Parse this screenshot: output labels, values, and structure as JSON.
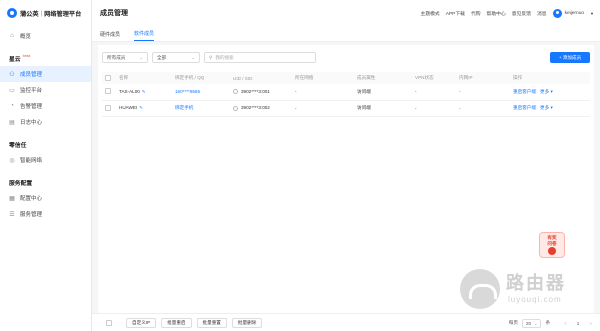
{
  "brand": {
    "name": "蒲公英",
    "subtitle": "网络管理平台"
  },
  "sidebar": {
    "top_items": [
      {
        "label": "概览",
        "icon": "home-icon"
      }
    ],
    "groups": [
      {
        "title": "星云",
        "tag": "beta",
        "items": [
          {
            "label": "成员管理",
            "icon": "users-icon",
            "active": true
          },
          {
            "label": "监控平台",
            "icon": "monitor-icon"
          },
          {
            "label": "告警管理",
            "icon": "bell-icon"
          },
          {
            "label": "日志中心",
            "icon": "log-icon"
          }
        ]
      },
      {
        "title": "零信任",
        "items": [
          {
            "label": "智能网络",
            "icon": "network-icon"
          }
        ]
      },
      {
        "title": "服务配置",
        "items": [
          {
            "label": "配置中心",
            "icon": "grid-icon"
          },
          {
            "label": "服务管理",
            "icon": "list-icon"
          }
        ]
      }
    ]
  },
  "header": {
    "title": "成员管理",
    "links": [
      "主题模式",
      "APP下载",
      "代购",
      "帮助中心",
      "意见反馈",
      "消息"
    ],
    "username": "keijernuo"
  },
  "tabs": [
    {
      "label": "硬件成员"
    },
    {
      "label": "软件成员",
      "active": true
    }
  ],
  "filters": {
    "type_select": "所有成员",
    "status_select": "全部",
    "search_placeholder": "我的搜索"
  },
  "add_button": "+ 添加成员",
  "table": {
    "columns": [
      "名称",
      "绑定手机 / QQ",
      "UID / SID",
      "所在网络",
      "成员属性",
      "VPN状态",
      "内网IP",
      "操作"
    ],
    "rows": [
      {
        "name": "TAS-AL00",
        "phone": "150****9555",
        "uid": "3902****3:001",
        "network": "-",
        "attr": "访问端",
        "vpn": "-",
        "ip": "-",
        "op": "重启客户端",
        "more": "更多 ▾"
      },
      {
        "name": "HUAWEI",
        "phone": "绑定手机",
        "uid": "3902****3:002",
        "network": "-",
        "attr": "访问端",
        "vpn": "-",
        "ip": "-",
        "op": "重启客户端",
        "more": "更多 ▾"
      }
    ]
  },
  "bottom": {
    "buttons": [
      "自定义IP",
      "批量重启",
      "批量重置",
      "批量删除"
    ],
    "pager": {
      "prefix": "每页",
      "size": "20",
      "suffix": "条",
      "page": "1",
      "prev": "<",
      "next": ">"
    }
  },
  "promo": {
    "line1": "有奖",
    "line2": "问卷"
  },
  "watermark": {
    "title": "路由器",
    "sub": "luyouqi.com"
  }
}
